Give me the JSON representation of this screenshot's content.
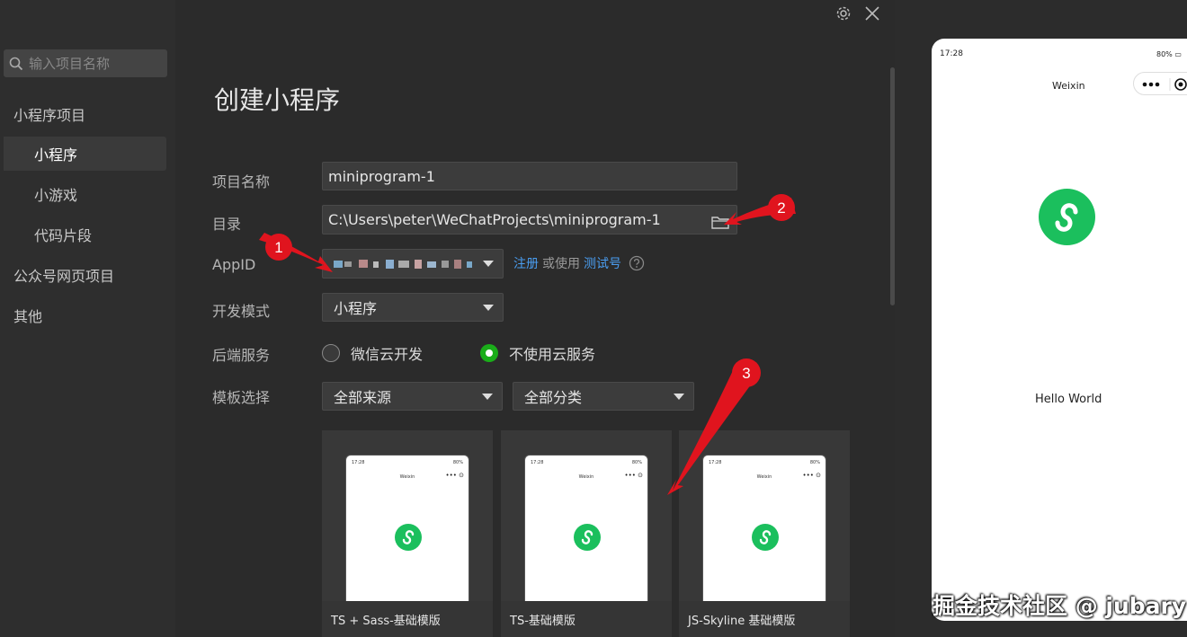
{
  "sidebar": {
    "search_placeholder": "输入项目名称",
    "categories": [
      {
        "label": "小程序项目"
      },
      {
        "label": "小程序",
        "active": true
      },
      {
        "label": "小游戏"
      },
      {
        "label": "代码片段"
      },
      {
        "label": "公众号网页项目"
      },
      {
        "label": "其他"
      }
    ]
  },
  "header": {
    "title": "创建小程序"
  },
  "form": {
    "name_label": "项目名称",
    "name_value": "miniprogram-1",
    "dir_label": "目录",
    "dir_value": "C:\\Users\\peter\\WeChatProjects\\miniprogram-1",
    "appid_label": "AppID",
    "register_link": "注册",
    "or_use_text": "或使用",
    "test_account_link": "测试号",
    "mode_label": "开发模式",
    "mode_value": "小程序",
    "backend_label": "后端服务",
    "backend_option_cloud": "微信云开发",
    "backend_option_none": "不使用云服务",
    "template_label": "模板选择",
    "template_source": "全部来源",
    "template_category": "全部分类"
  },
  "templates": [
    {
      "label": "TS + Sass-基础模版"
    },
    {
      "label": "TS-基础模版"
    },
    {
      "label": "JS-Skyline 基础模版"
    }
  ],
  "annotations": {
    "one": "1",
    "two": "2",
    "three": "3"
  },
  "preview": {
    "time": "17:28",
    "battery": "80%",
    "nav_title": "Weixin",
    "hello_text": "Hello World",
    "mini_time": "17:28",
    "mini_battery": "80%",
    "mini_title": "Weixin"
  },
  "watermark": "掘金技术社区 @ jubary",
  "colors": {
    "accent_green": "#1aad19",
    "link_blue": "#4a9df0",
    "logo_green": "#1bbf5d",
    "annotation_red": "#e0141e"
  }
}
